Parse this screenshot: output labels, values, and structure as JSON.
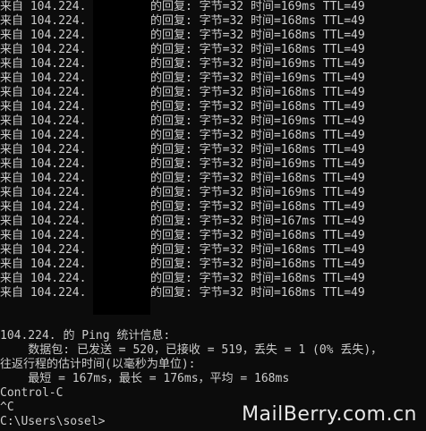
{
  "replies": [
    {
      "from": "来自 104.224.",
      "reply": "的回复: 字节=32 时间=169ms TTL=49"
    },
    {
      "from": "来自 104.224.",
      "reply": "的回复: 字节=32 时间=168ms TTL=49"
    },
    {
      "from": "来自 104.224.",
      "reply": "的回复: 字节=32 时间=168ms TTL=49"
    },
    {
      "from": "来自 104.224.",
      "reply": "的回复: 字节=32 时间=168ms TTL=49"
    },
    {
      "from": "来自 104.224.",
      "reply": "的回复: 字节=32 时间=169ms TTL=49"
    },
    {
      "from": "来自 104.224.",
      "reply": "的回复: 字节=32 时间=169ms TTL=49"
    },
    {
      "from": "来自 104.224.",
      "reply": "的回复: 字节=32 时间=168ms TTL=49"
    },
    {
      "from": "来自 104.224.",
      "reply": "的回复: 字节=32 时间=168ms TTL=49"
    },
    {
      "from": "来自 104.224.",
      "reply": "的回复: 字节=32 时间=169ms TTL=49"
    },
    {
      "from": "来自 104.224.",
      "reply": "的回复: 字节=32 时间=168ms TTL=49"
    },
    {
      "from": "来自 104.224.",
      "reply": "的回复: 字节=32 时间=168ms TTL=49"
    },
    {
      "from": "来自 104.224.",
      "reply": "的回复: 字节=32 时间=169ms TTL=49"
    },
    {
      "from": "来自 104.224.",
      "reply": "的回复: 字节=32 时间=168ms TTL=49"
    },
    {
      "from": "来自 104.224.",
      "reply": "的回复: 字节=32 时间=169ms TTL=49"
    },
    {
      "from": "来自 104.224.",
      "reply": "的回复: 字节=32 时间=168ms TTL=49"
    },
    {
      "from": "来自 104.224.",
      "reply": "的回复: 字节=32 时间=167ms TTL=49"
    },
    {
      "from": "来自 104.224.",
      "reply": "的回复: 字节=32 时间=168ms TTL=49"
    },
    {
      "from": "来自 104.224.",
      "reply": "的回复: 字节=32 时间=168ms TTL=49"
    },
    {
      "from": "来自 104.224.",
      "reply": "的回复: 字节=32 时间=168ms TTL=49"
    },
    {
      "from": "来自 104.224.",
      "reply": "的回复: 字节=32 时间=168ms TTL=49"
    },
    {
      "from": "来自 104.224.",
      "reply": "的回复: 字节=32 时间=168ms TTL=49"
    }
  ],
  "stats": {
    "header_prefix": "104.224.",
    "header_suffix": " 的 Ping 统计信息:",
    "packets": "    数据包: 已发送 = 520，已接收 = 519，丢失 = 1 (0% 丢失)，",
    "rtt_header": "往返行程的估计时间(以毫秒为单位):",
    "rtt": "    最短 = 167ms，最长 = 176ms，平均 = 168ms"
  },
  "interrupt": "Control-C",
  "caret": "^C",
  "prompt": "C:\\Users\\sosel>",
  "watermark": "MailBerry.com.cn"
}
